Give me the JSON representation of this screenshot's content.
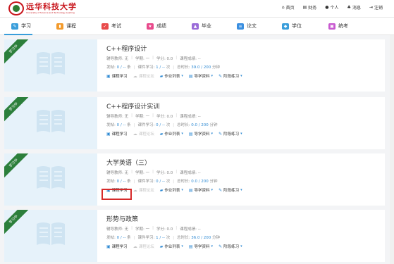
{
  "header": {
    "logo_text": "远华科技大学",
    "logo_subtitle": "University of Science and Technology Leading",
    "topnav": [
      {
        "label": "首页",
        "icon": "home-icon",
        "glyph": "⌂"
      },
      {
        "label": "财务",
        "icon": "finance-icon",
        "glyph": "▤"
      },
      {
        "label": "个人",
        "icon": "user-icon",
        "glyph": "●"
      },
      {
        "label": "消息",
        "icon": "bell-icon",
        "glyph": "♣"
      },
      {
        "label": "注销",
        "icon": "logout-icon",
        "glyph": "⇥"
      }
    ]
  },
  "nav": {
    "items": [
      {
        "label": "学习",
        "icon": "study-icon",
        "color": "#3a9edb",
        "glyph": "✎"
      },
      {
        "label": "课程",
        "icon": "course-icon",
        "color": "#f39a2b",
        "glyph": "▮"
      },
      {
        "label": "考试",
        "icon": "exam-icon",
        "color": "#e84a4a",
        "glyph": "✓"
      },
      {
        "label": "成绩",
        "icon": "grade-icon",
        "color": "#e84a8c",
        "glyph": "★"
      },
      {
        "label": "毕业",
        "icon": "graduation-icon",
        "color": "#9a6cd8",
        "glyph": "▲"
      },
      {
        "label": "论文",
        "icon": "thesis-icon",
        "color": "#3a8fe0",
        "glyph": "≡"
      },
      {
        "label": "学位",
        "icon": "degree-icon",
        "color": "#3a9edb",
        "glyph": "◆"
      },
      {
        "label": "统考",
        "icon": "unified-exam-icon",
        "color": "#c85ad0",
        "glyph": "▣"
      }
    ]
  },
  "labels": {
    "ribbon": "学习中",
    "tutor": "辅导教师: 无",
    "credit_hours": "学期: 一",
    "credit": "学分: 0.0",
    "grade": "课程成绩: --",
    "posts_prefix": "发帖: ",
    "posts_suffix": " 条",
    "study_prefix": "课件学习: ",
    "study_suffix": " 次",
    "duration_prefix": "总时长: ",
    "duration_suffix": " 分钟",
    "action_study": "课程学习",
    "action_forum": "课程论坛",
    "action_homework": "作业列表",
    "action_materials": "导学资料",
    "action_practice": "阶段练习"
  },
  "courses": [
    {
      "title": "C++程序设计",
      "posts": "0 / -- 条",
      "study": "1 / -- 次",
      "duration": "39.0 / 200 分钟",
      "posts_hl": "0 / --",
      "study_hl": "1 / --",
      "duration_hl": "39.0 / 200"
    },
    {
      "title": "C++程序设计实训",
      "posts_hl": "0 / --",
      "study_hl": "0 / --",
      "duration_hl": "0.0 / 200"
    },
    {
      "title": "大学英语（三）",
      "posts_hl": "0 / --",
      "study_hl": "0 / --",
      "duration_hl": "0.0 / 200"
    },
    {
      "title": "形势与政策",
      "posts_hl": "0 / --",
      "study_hl": "1 / --",
      "duration_hl": "36.0 / 200"
    }
  ]
}
